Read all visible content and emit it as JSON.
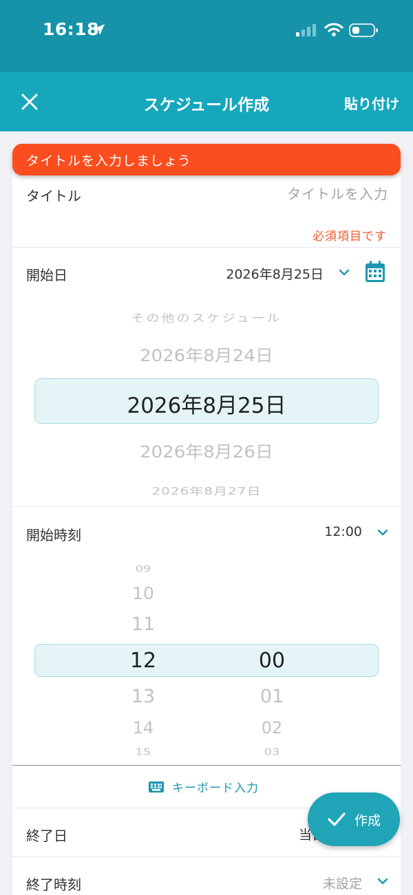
{
  "status_bar": {
    "time": "16:18"
  },
  "nav": {
    "title": "スケジュール作成",
    "paste_label": "貼り付け"
  },
  "toast": {
    "message": "タイトルを入力しましょう"
  },
  "title_field": {
    "label": "タイトル",
    "placeholder": "タイトルを入力",
    "error": "必須項目です"
  },
  "start_date": {
    "label": "開始日",
    "value": "2026年8月25日",
    "picker": {
      "above2": "その他のスケジュール",
      "above1": "2026年8月24日",
      "selected": "2026年8月25日",
      "below1": "2026年8月26日",
      "below2": "2026年8月27日"
    }
  },
  "start_time": {
    "label": "開始時刻",
    "value": "12:00",
    "hours": [
      "09",
      "10",
      "11",
      "12",
      "13",
      "14",
      "15"
    ],
    "minutes": [
      "00",
      "01",
      "02",
      "03"
    ]
  },
  "keyboard_input": {
    "label": "キーボード入力"
  },
  "end_date": {
    "label": "終了日",
    "value": "当日"
  },
  "end_time": {
    "label": "終了時刻",
    "value": "未設定"
  },
  "fab": {
    "label": "作成"
  },
  "colors": {
    "header": "#1693a9",
    "nav": "#16a7bd",
    "accent": "#1c97b0",
    "error": "#fb4d1e"
  }
}
